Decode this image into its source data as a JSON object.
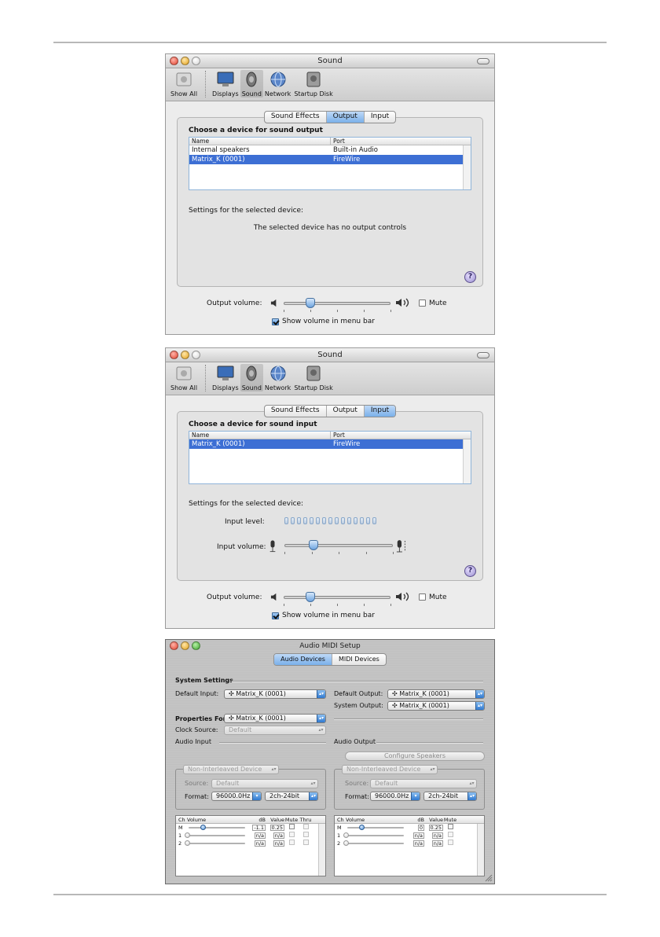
{
  "windows": {
    "output": {
      "title": "Sound",
      "toolbar": [
        "Show All",
        "Displays",
        "Sound",
        "Network",
        "Startup Disk"
      ],
      "tabs": [
        "Sound Effects",
        "Output",
        "Input"
      ],
      "active_tab": "Output",
      "heading": "Choose a device for sound output",
      "columns": [
        "Name",
        "Port"
      ],
      "rows": [
        {
          "name": "Internal speakers",
          "port": "Built-in Audio"
        },
        {
          "name": "Matrix_K (0001)",
          "port": "FireWire"
        }
      ],
      "selected_row": 1,
      "settings_label": "Settings for the selected device:",
      "no_controls": "The selected device has no output controls",
      "output_volume_label": "Output volume:",
      "output_volume_level": 0.25,
      "mute_label": "Mute",
      "show_volume_label": "Show volume in menu bar",
      "help": "?"
    },
    "input": {
      "title": "Sound",
      "toolbar": [
        "Show All",
        "Displays",
        "Sound",
        "Network",
        "Startup Disk"
      ],
      "tabs": [
        "Sound Effects",
        "Output",
        "Input"
      ],
      "active_tab": "Input",
      "heading": "Choose a device for sound input",
      "columns": [
        "Name",
        "Port"
      ],
      "rows": [
        {
          "name": "Matrix_K (0001)",
          "port": "FireWire"
        }
      ],
      "selected_row": 0,
      "settings_label": "Settings for the selected device:",
      "input_level_label": "Input level:",
      "input_level_segments": 15,
      "input_volume_label": "Input volume:",
      "input_volume_level": 0.27,
      "output_volume_label": "Output volume:",
      "output_volume_level": 0.25,
      "mute_label": "Mute",
      "show_volume_label": "Show volume in menu bar",
      "help": "?"
    },
    "midi": {
      "title": "Audio MIDI Setup",
      "tabs": [
        "Audio Devices",
        "MIDI Devices"
      ],
      "active_tab": "Audio Devices",
      "system_settings": "System Settings",
      "default_input_label": "Default Input:",
      "default_input_value": "Matrix_K (0001)",
      "default_output_label": "Default Output:",
      "default_output_value": "Matrix_K (0001)",
      "system_output_label": "System Output:",
      "system_output_value": "Matrix_K (0001)",
      "properties_label": "Properties For:",
      "properties_value": "Matrix_K (0001)",
      "clock_source_label": "Clock Source:",
      "clock_source_value": "Default",
      "audio_input": "Audio Input",
      "audio_output": "Audio Output",
      "configure_speakers": "Configure Speakers",
      "non_interleaved": "Non-Interleaved Device",
      "source_label": "Source:",
      "source_value": "Default",
      "format_label": "Format:",
      "format_rate": "96000.0Hz",
      "format_bits": "2ch-24bit",
      "mixer_columns_in": [
        "Ch",
        "Volume",
        "dB",
        "Value",
        "Mute",
        "Thru"
      ],
      "mixer_columns_out": [
        "Ch",
        "Volume",
        "dB",
        "Value",
        "Mute"
      ],
      "input_channels": [
        {
          "ch": "M",
          "level": 0.25,
          "db": "-1.1",
          "value": "0.25"
        },
        {
          "ch": "1",
          "level": 0,
          "db": "n/a",
          "value": "n/a"
        },
        {
          "ch": "2",
          "level": 0,
          "db": "n/a",
          "value": "n/a"
        }
      ],
      "output_channels": [
        {
          "ch": "M",
          "level": 0.25,
          "db": "0",
          "value": "0.25"
        },
        {
          "ch": "1",
          "level": 0,
          "db": "n/a",
          "value": "n/a"
        },
        {
          "ch": "2",
          "level": 0,
          "db": "n/a",
          "value": "n/a"
        }
      ]
    }
  }
}
